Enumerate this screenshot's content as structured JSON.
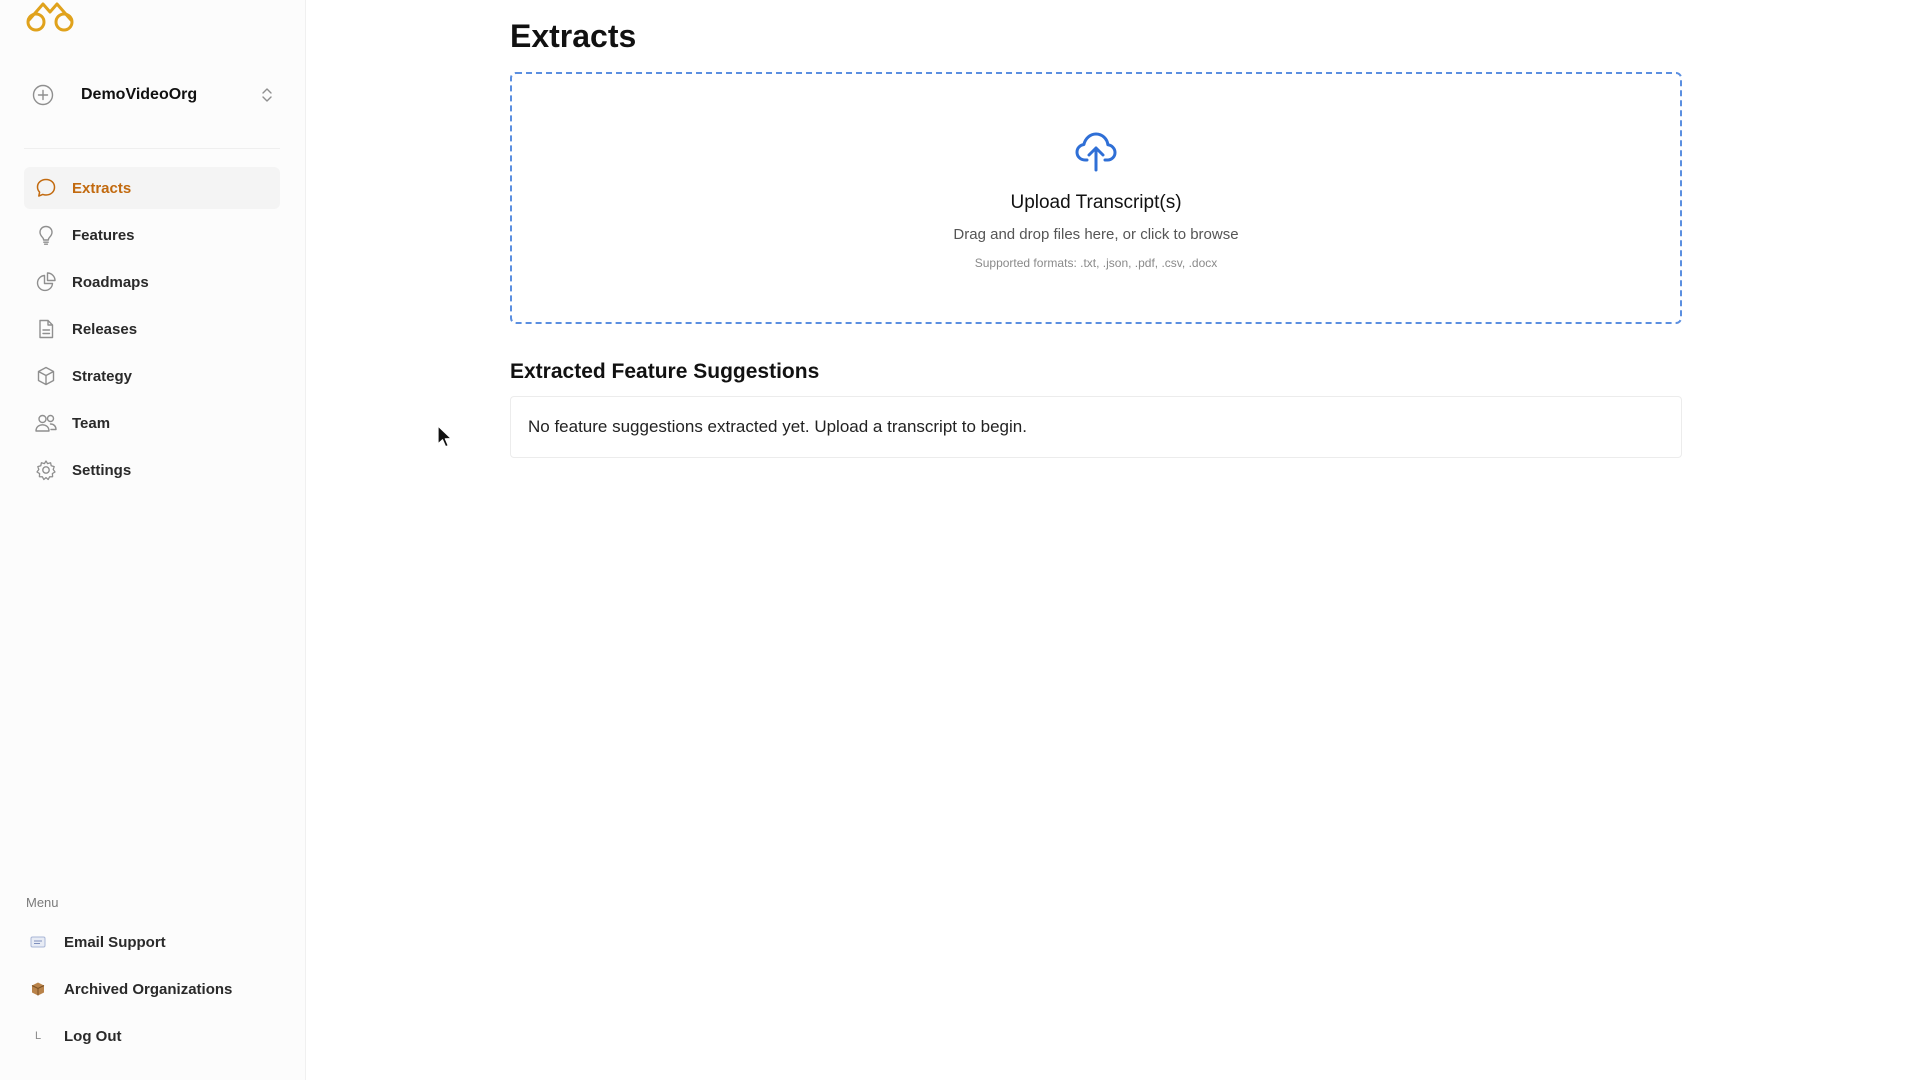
{
  "colors": {
    "accent": "#c26a0f",
    "logo": "#e0a21c",
    "upload_border": "#5b8fe0",
    "upload_icon": "#2f6fd6",
    "icon_gray": "#8f8f8f"
  },
  "sidebar": {
    "logo_icon": "glasses-logo-icon",
    "org": {
      "name": "DemoVideoOrg",
      "icon": "plus-circle-icon",
      "chevron_icon": "chevron-up-down-icon"
    },
    "nav": [
      {
        "label": "Extracts",
        "icon": "chat-bubble-icon",
        "active": true
      },
      {
        "label": "Features",
        "icon": "lightbulb-icon",
        "active": false
      },
      {
        "label": "Roadmaps",
        "icon": "pie-chart-icon",
        "active": false
      },
      {
        "label": "Releases",
        "icon": "document-icon",
        "active": false
      },
      {
        "label": "Strategy",
        "icon": "cube-icon",
        "active": false
      },
      {
        "label": "Team",
        "icon": "users-icon",
        "active": false
      },
      {
        "label": "Settings",
        "icon": "gear-icon",
        "active": false
      }
    ],
    "menu_heading": "Menu",
    "menu": [
      {
        "label": "Email Support",
        "icon": "email-icon"
      },
      {
        "label": "Archived Organizations",
        "icon": "archive-box-icon"
      },
      {
        "label": "Log Out",
        "icon": "logout-icon",
        "glyph": "L"
      }
    ]
  },
  "main": {
    "title": "Extracts",
    "upload": {
      "icon": "cloud-upload-icon",
      "title": "Upload Transcript(s)",
      "subtitle": "Drag and drop files here, or click to browse",
      "formats": "Supported formats: .txt, .json, .pdf, .csv, .docx"
    },
    "suggestions": {
      "title": "Extracted Feature Suggestions",
      "empty_text": "No feature suggestions extracted yet. Upload a transcript to begin."
    }
  }
}
